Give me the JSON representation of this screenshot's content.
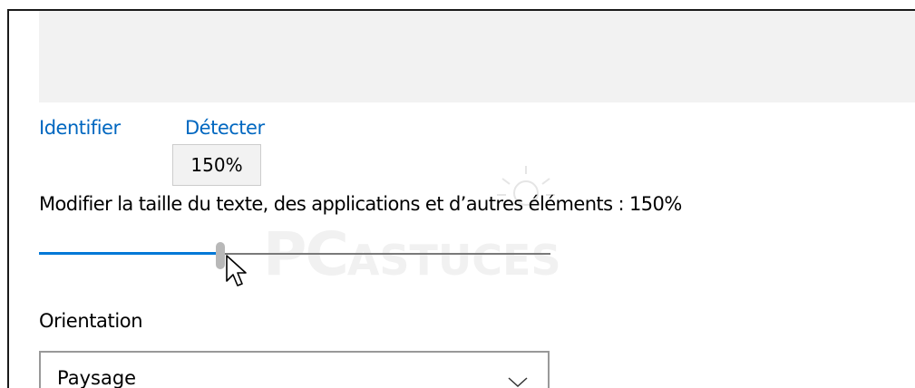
{
  "links": {
    "identify": "Identifier",
    "detect": "Détecter"
  },
  "scale": {
    "label": "Modifier la taille du texte, des applications et d’autres éléments : 150%",
    "tooltip": "150%",
    "slider_value_fraction": 0.354
  },
  "orientation": {
    "label": "Orientation",
    "selected": "Paysage"
  },
  "watermark": {
    "brand_big": "PC",
    "brand_small": "ASTUCES"
  },
  "colors": {
    "accent": "#0078d7",
    "link": "#0067c0",
    "preview_bg": "#f2f2f2"
  },
  "icons": {
    "cursor": "mouse-pointer-icon",
    "chevron": "chevron-down-icon",
    "bulb": "lightbulb-watermark-icon"
  }
}
